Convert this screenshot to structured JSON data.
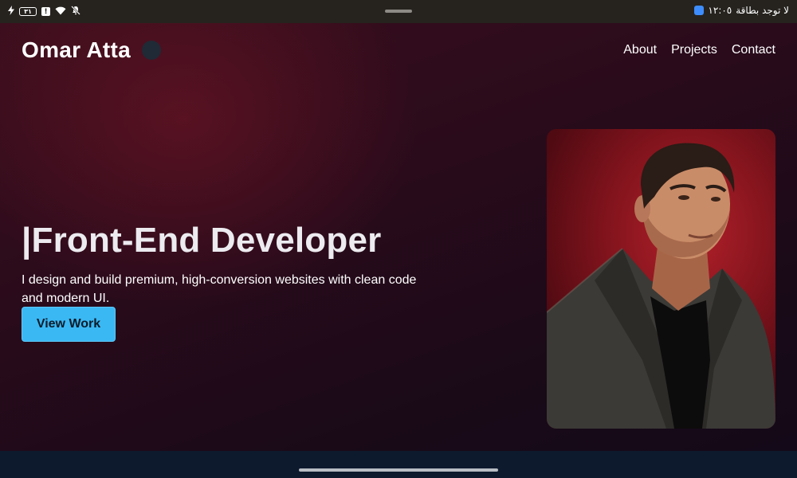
{
  "status_bar": {
    "battery": "٣١",
    "alert": "!",
    "right_text": "لا توجد بطاقة",
    "time": "١٢:٠٥"
  },
  "site": {
    "brand": "Omar Atta",
    "nav": [
      {
        "label": "About"
      },
      {
        "label": "Projects"
      },
      {
        "label": "Contact"
      }
    ]
  },
  "hero": {
    "headline": "|Front-End Developer",
    "tagline": "I design and build premium, high-conversion websites with clean code and modern UI.",
    "cta": "View Work"
  },
  "colors": {
    "accent": "#3ab8f4",
    "background": "#2a0b1b",
    "footer": "#0d1a2e"
  },
  "icons": {
    "status_left": [
      "charging-icon",
      "battery-icon",
      "alert-icon",
      "wifi-icon",
      "notifications-muted-icon"
    ],
    "status_right": [
      "app-notification-icon"
    ]
  }
}
